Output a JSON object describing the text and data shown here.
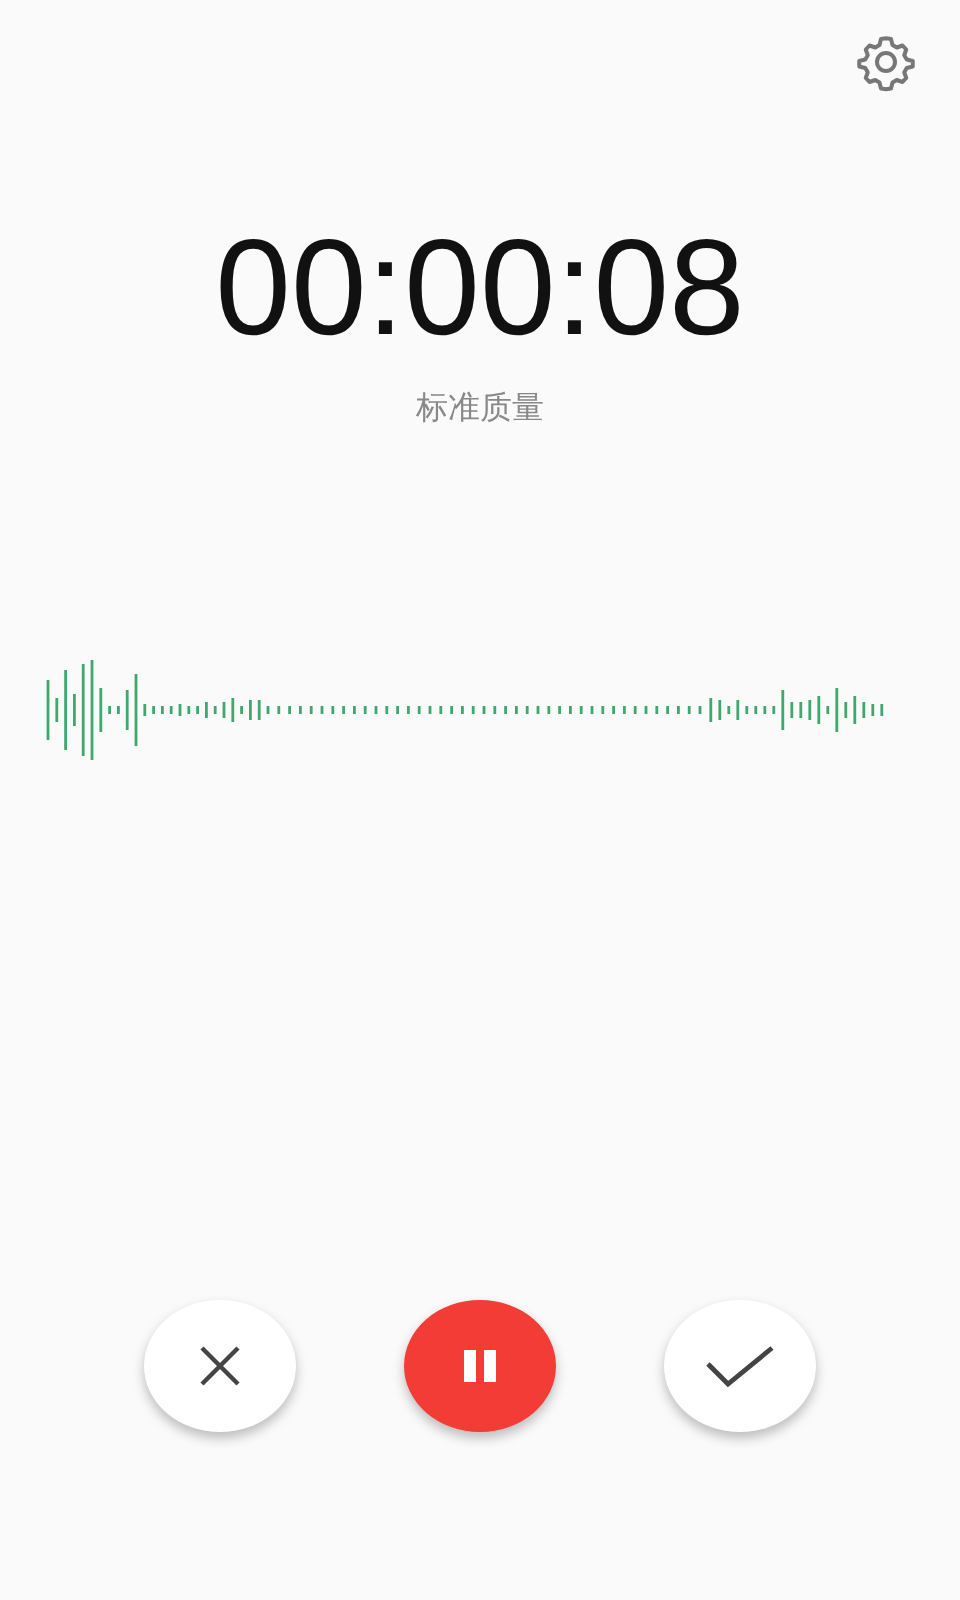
{
  "timer": "00:00:08",
  "quality": "标准质量"
}
